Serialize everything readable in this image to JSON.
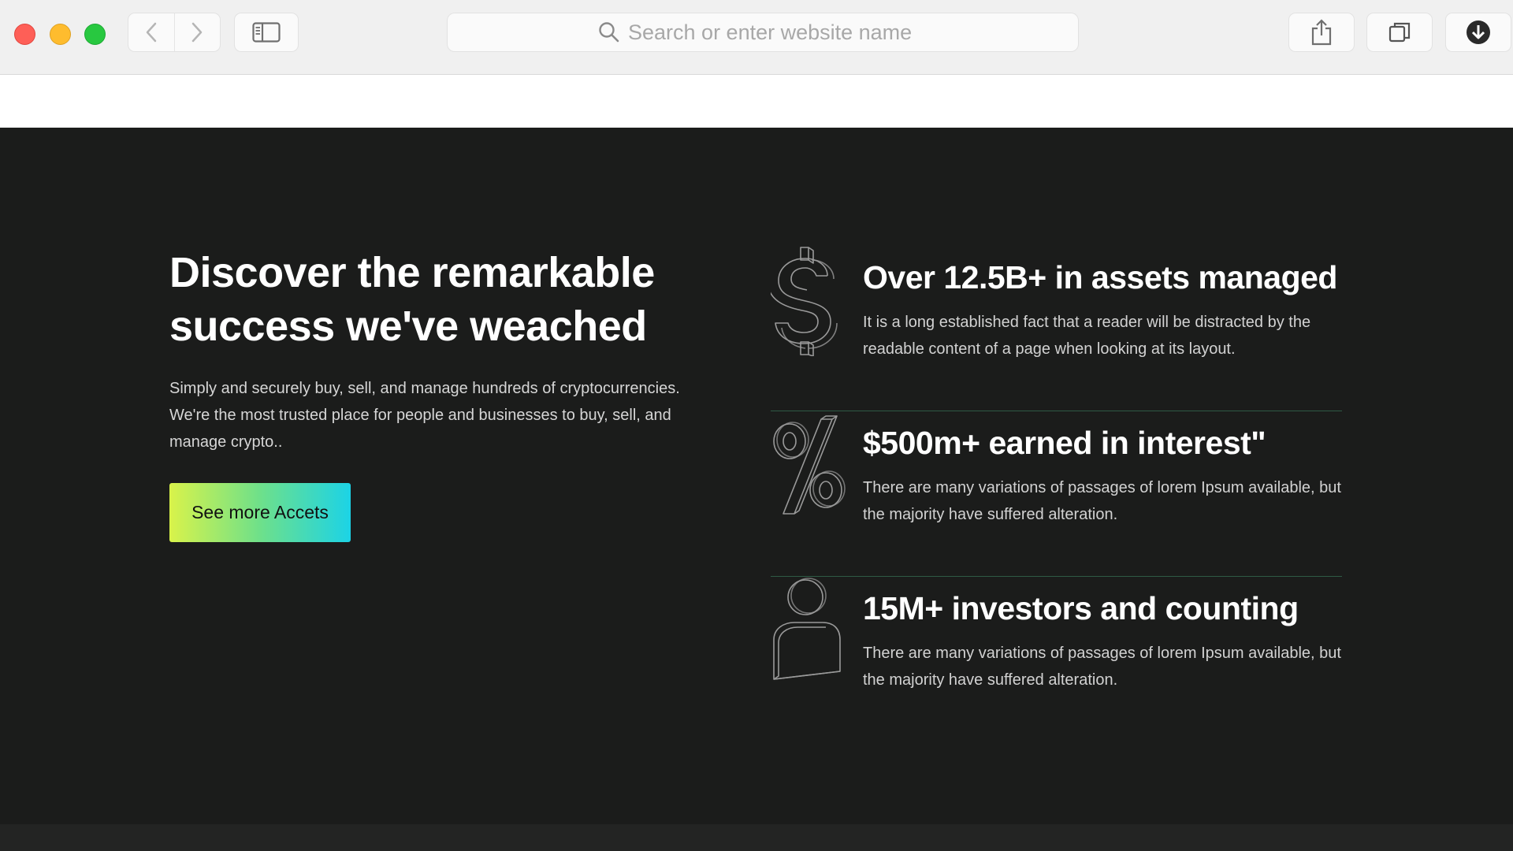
{
  "browser": {
    "address_placeholder": "Search or enter website name",
    "icons": [
      "back-icon",
      "forward-icon",
      "sidebar-icon",
      "search-icon",
      "share-icon",
      "tabs-icon",
      "download-icon"
    ]
  },
  "hero": {
    "headline_line1": "Discover the remarkable",
    "headline_line2": "success we've weached",
    "description": "Simply and securely buy, sell, and manage hundreds of cryptocurrencies. We're the most trusted place for people and businesses to buy, sell, and manage crypto..",
    "cta_label": "See more Accets"
  },
  "stats": [
    {
      "icon": "dollar-icon",
      "title": "Over 12.5B+ in assets managed",
      "description": "It is a long established fact that a reader will be distracted by the readable content of a page when looking at its layout."
    },
    {
      "icon": "percent-icon",
      "title": "$500m+ earned in interest\"",
      "description": "There are many variations of passages of lorem Ipsum available, but the majority have suffered alteration."
    },
    {
      "icon": "user-icon",
      "title": "15M+ investors and counting",
      "description": "There are many variations of passages of lorem Ipsum available, but the majority have suffered alteration."
    }
  ],
  "colors": {
    "background": "#1b1c1b",
    "divider": "#2e5a45",
    "cta_gradient_start": "#d9f34a",
    "cta_gradient_end": "#1cd3e6"
  }
}
